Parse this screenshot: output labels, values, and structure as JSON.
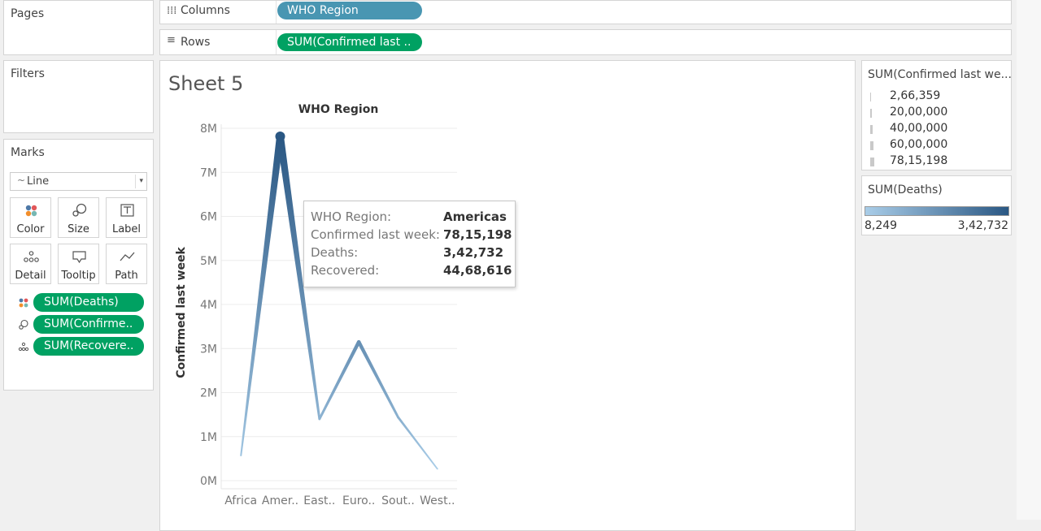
{
  "panels": {
    "pages": {
      "title": "Pages"
    },
    "filters": {
      "title": "Filters"
    },
    "marks": {
      "title": "Marks"
    }
  },
  "shelves": {
    "columns": {
      "label": "Columns",
      "icon": "columns-icon",
      "pill": "WHO Region"
    },
    "rows": {
      "label": "Rows",
      "icon": "rows-icon",
      "pill": "SUM(Confirmed last .."
    }
  },
  "marks": {
    "type": "Line",
    "buttons": {
      "color": "Color",
      "size": "Size",
      "label": "Label",
      "detail": "Detail",
      "tooltip": "Tooltip",
      "path": "Path"
    },
    "fields": [
      {
        "label": "SUM(Deaths)",
        "icon": "color-dots-icon"
      },
      {
        "label": "SUM(Confirme..",
        "icon": "size-icon"
      },
      {
        "label": "SUM(Recovere..",
        "icon": "detail-icon"
      }
    ]
  },
  "sheet": {
    "title": "Sheet 5"
  },
  "chart_data": {
    "type": "line",
    "title": "WHO Region",
    "xlabel": "",
    "ylabel": "Confirmed last week",
    "categories": [
      "Africa",
      "Amer..",
      "East..",
      "Euro..",
      "Sout..",
      "West.."
    ],
    "values": [
      557000,
      7815198,
      1400000,
      3150000,
      1440000,
      266359
    ],
    "deaths_color_values": [
      12000,
      342732,
      35000,
      120000,
      40000,
      8249
    ],
    "ylim": [
      0,
      8000000
    ],
    "yticks": [
      0,
      1000000,
      2000000,
      3000000,
      4000000,
      5000000,
      6000000,
      7000000,
      8000000
    ],
    "ytick_labels": [
      "0M",
      "1M",
      "2M",
      "3M",
      "4M",
      "5M",
      "6M",
      "7M",
      "8M"
    ],
    "grid": true,
    "highlight_index": 1
  },
  "tooltip": {
    "rows": [
      {
        "key": "WHO Region:",
        "value": "Americas"
      },
      {
        "key": "Confirmed last week:",
        "value": "78,15,198"
      },
      {
        "key": "Deaths:",
        "value": "3,42,732"
      },
      {
        "key": "Recovered:",
        "value": "44,68,616"
      }
    ]
  },
  "legends": {
    "size": {
      "title": "SUM(Confirmed last we...",
      "items": [
        "2,66,359",
        "20,00,000",
        "40,00,000",
        "60,00,000",
        "78,15,198"
      ]
    },
    "color": {
      "title": "SUM(Deaths)",
      "min": "8,249",
      "max": "3,42,732",
      "color_low": "#a9cde8",
      "color_high": "#2a5783"
    }
  }
}
